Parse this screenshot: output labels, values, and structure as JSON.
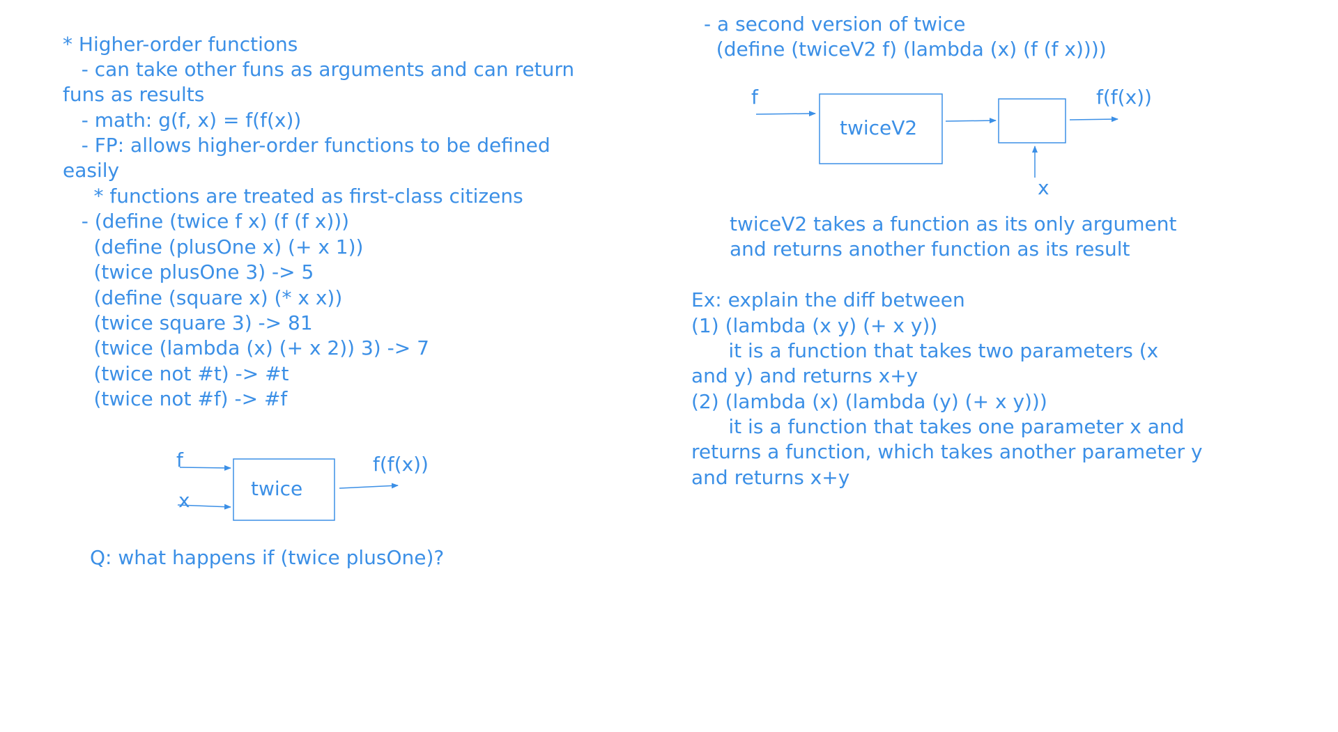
{
  "left_notes": {
    "lines": [
      "* Higher-order functions",
      "   - can take other funs as arguments and can return",
      "funs as results",
      "   - math: g(f, x) = f(f(x))",
      "   - FP: allows higher-order functions to be defined",
      "easily",
      "     * functions are treated as first-class citizens",
      "   - (define (twice f x) (f (f x)))",
      "     (define (plusOne x) (+ x 1))",
      "     (twice plusOne 3) -> 5",
      "     (define (square x) (* x x))",
      "     (twice square 3) -> 81",
      "     (twice (lambda (x) (+ x 2)) 3) -> 7",
      "     (twice not #t) -> #t",
      "     (twice not #f) -> #f"
    ]
  },
  "twice_diagram": {
    "input_f": "f",
    "input_x": "x",
    "box_label": "twice",
    "output": "f(f(x))"
  },
  "question": "Q: what happens if (twice plusOne)?",
  "right_top": {
    "lines": [
      "- a second version of twice",
      "  (define (twiceV2 f) (lambda (x) (f (f x))))"
    ]
  },
  "twicev2_diagram": {
    "input_f": "f",
    "box_label": "twiceV2",
    "input_x": "x",
    "output": "f(f(x))"
  },
  "twicev2_desc": {
    "lines": [
      "twiceV2 takes a function as its only argument",
      "and returns another function as its result"
    ]
  },
  "exercise": {
    "lines": [
      "Ex: explain the diff between",
      "(1) (lambda (x y) (+ x y))",
      "      it is a function that takes two parameters (x",
      "and y) and returns x+y",
      "(2) (lambda (x) (lambda (y) (+ x y)))",
      "      it is a function that takes one parameter x and",
      "returns a function, which takes another parameter y",
      "and returns x+y"
    ]
  },
  "colors": {
    "ink": "#3b8fe6",
    "background": "#ffffff"
  }
}
